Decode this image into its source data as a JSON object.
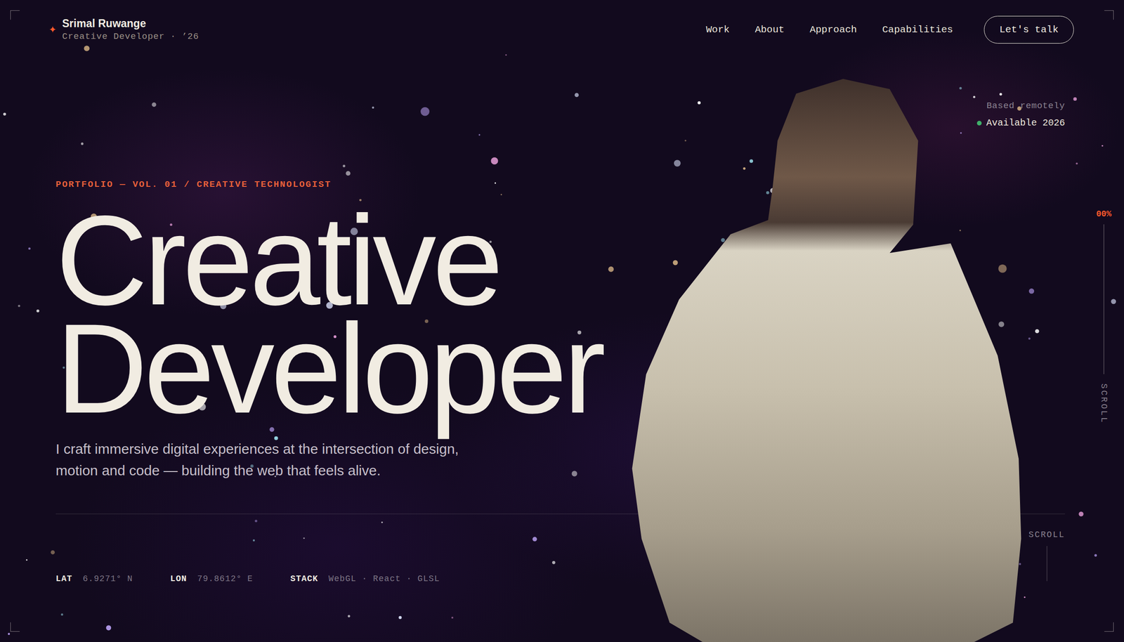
{
  "brand": {
    "icon": "✦",
    "name": "Srimal Ruwange",
    "tagline": "Creative Developer · ’26"
  },
  "nav": [
    {
      "label": "Work"
    },
    {
      "label": "About"
    },
    {
      "label": "Approach"
    },
    {
      "label": "Capabilities"
    }
  ],
  "cta": "Let's talk",
  "status": {
    "location": "Based remotely",
    "availability": "Available 2026",
    "available": true
  },
  "progress": {
    "reading": "00%",
    "level": 0,
    "label": "SCROLL"
  },
  "hero": {
    "eyebrow": "PORTFOLIO — VOL. 01 / CREATIVE TECHNOLOGIST",
    "title": [
      "Creative",
      "Developer"
    ],
    "intro": "I craft immersive digital experiences at the intersection of design, motion and code — building the web that feels alive."
  },
  "meta": [
    {
      "label": "LAT",
      "value": "6.9271° N"
    },
    {
      "label": "LON",
      "value": "79.8612° E"
    },
    {
      "label": "STACK",
      "value": "WebGL · React · GLSL"
    }
  ],
  "scroll_hint": "SCROLL"
}
